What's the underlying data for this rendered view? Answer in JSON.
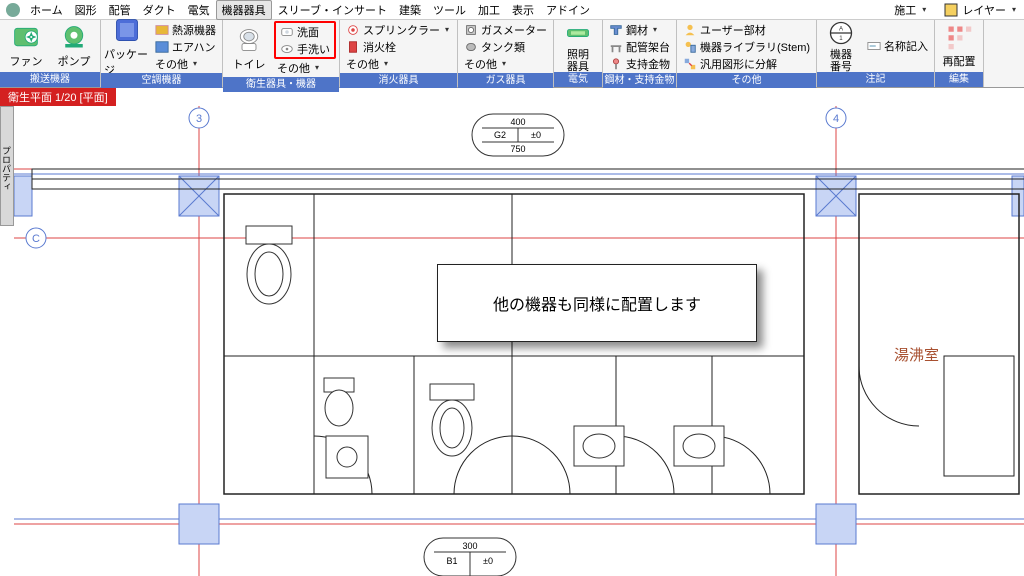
{
  "menu": {
    "items": [
      "ホーム",
      "図形",
      "配管",
      "ダクト",
      "電気",
      "機器器具",
      "スリーブ・インサート",
      "建築",
      "ツール",
      "加工",
      "表示",
      "アドイン"
    ],
    "active_index": 5,
    "right": {
      "kougu": "施工",
      "layer": "レイヤー"
    }
  },
  "ribbon": {
    "groups": [
      {
        "label": "搬送機器",
        "big": [
          {
            "name": "fan",
            "text": "ファン"
          },
          {
            "name": "pump",
            "text": "ポンプ"
          }
        ]
      },
      {
        "label": "空調機器",
        "big": [
          {
            "name": "package",
            "text": "パッケージ"
          }
        ],
        "small": [
          {
            "name": "heat",
            "text": "熱源機器"
          },
          {
            "name": "airhan",
            "text": "エアハン"
          },
          {
            "name": "other",
            "text": "その他"
          }
        ]
      },
      {
        "label": "衛生器具・機器",
        "big": [
          {
            "name": "toilet",
            "text": "トイレ"
          }
        ],
        "small": [
          {
            "name": "washbasin",
            "text": "洗面"
          },
          {
            "name": "handwash",
            "text": "手洗い"
          },
          {
            "name": "other",
            "text": "その他"
          }
        ],
        "highlight": true
      },
      {
        "label": "消火器具",
        "big": [],
        "small": [
          {
            "name": "sprinkler",
            "text": "スプリンクラー"
          },
          {
            "name": "hydrant",
            "text": "消火栓"
          },
          {
            "name": "other",
            "text": "その他"
          }
        ]
      },
      {
        "label": "ガス器具",
        "big": [],
        "small": [
          {
            "name": "gasmeter",
            "text": "ガスメーター"
          },
          {
            "name": "tank",
            "text": "タンク類"
          },
          {
            "name": "other",
            "text": "その他"
          }
        ]
      },
      {
        "label": "電気",
        "big": [
          {
            "name": "light",
            "text": "照明\n器具"
          }
        ]
      },
      {
        "label": "鋼材・支持金物",
        "big": [],
        "small": [
          {
            "name": "steel",
            "text": "鋼材"
          },
          {
            "name": "piperack",
            "text": "配管架台"
          },
          {
            "name": "support",
            "text": "支持金物"
          }
        ]
      },
      {
        "label": "その他",
        "big": [],
        "small": [
          {
            "name": "userpart",
            "text": "ユーザー部材"
          },
          {
            "name": "stemlib",
            "text": "機器ライブラリ(Stem)"
          },
          {
            "name": "decompose",
            "text": "汎用図形に分解"
          }
        ]
      },
      {
        "label": "注記",
        "big": [
          {
            "name": "devnum",
            "text": "機器\n番号"
          }
        ],
        "small": [
          {
            "name": "nameinput",
            "text": "名称記入"
          }
        ]
      },
      {
        "label": "編集",
        "big": [
          {
            "name": "relocate",
            "text": "再配置"
          }
        ]
      }
    ]
  },
  "tab": {
    "label": "衛生平面 1/20 [平面]"
  },
  "sidetool": "プロパティ",
  "drawing": {
    "grid_cols": [
      "3",
      "4"
    ],
    "grid_row": "C",
    "size_tags": [
      {
        "top": "400",
        "mid_l": "G2",
        "mid_r": "±0",
        "bot": "750"
      },
      {
        "top": "300",
        "mid_l": "B1",
        "mid_r": "±0"
      }
    ],
    "room_label": "湯沸室"
  },
  "callout": "他の機器も同様に配置します"
}
